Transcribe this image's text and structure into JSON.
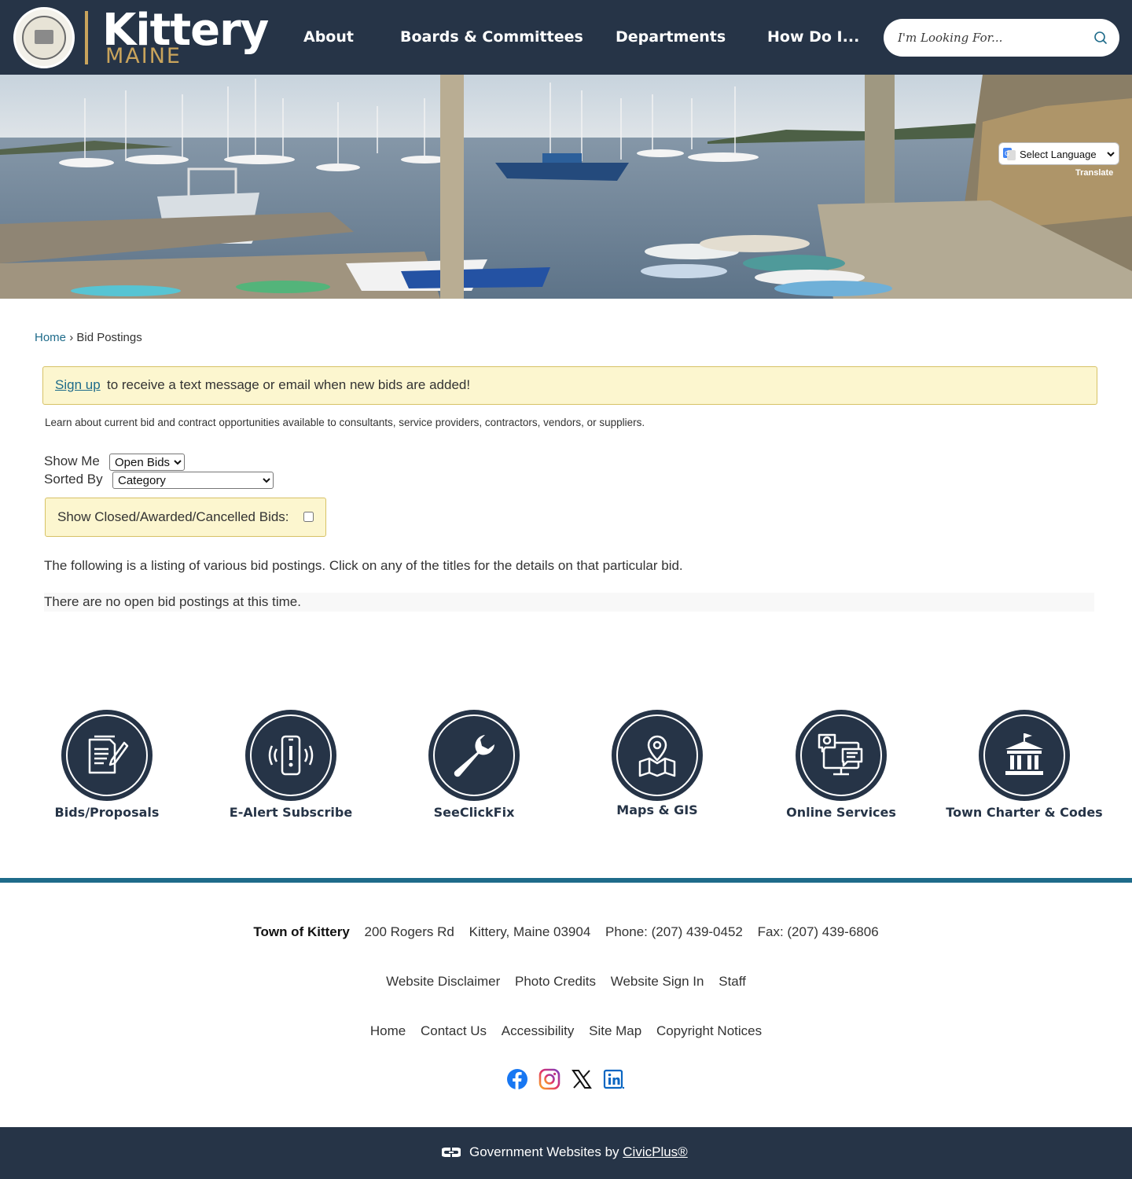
{
  "header": {
    "logo_name": "Kittery",
    "logo_state": "MAINE",
    "nav": [
      {
        "label": "About"
      },
      {
        "label": "Boards & Committees"
      },
      {
        "label": "Departments"
      },
      {
        "label": "How Do I..."
      }
    ],
    "search": {
      "placeholder": "I'm Looking For...",
      "icon": "search-icon"
    }
  },
  "translate": {
    "select_label": "Select Language",
    "credit": "Translate"
  },
  "breadcrumb": {
    "home": "Home",
    "separator": "›",
    "current": "Bid Postings"
  },
  "alert": {
    "link": "Sign up",
    "text": "to receive a text message or email when new bids are added!"
  },
  "intro": "Learn about current bid and contract opportunities available to consultants, service providers, contractors, vendors, or suppliers.",
  "filters": {
    "show_me_label": "Show Me",
    "show_me_value": "Open Bids",
    "sorted_by_label": "Sorted By",
    "sorted_by_value": "Category",
    "closed_label": "Show Closed/Awarded/Cancelled Bids:",
    "closed_checked": false
  },
  "listing_text": "The following is a listing of various bid postings. Click on any of the titles for the details on that particular bid.",
  "no_bids_text": "There are no open bid postings at this time.",
  "quick_links": [
    {
      "label": "Bids/Proposals",
      "icon": "document-pen-icon"
    },
    {
      "label": "E-Alert Subscribe",
      "icon": "phone-alert-icon"
    },
    {
      "label": "SeeClickFix",
      "icon": "wrench-icon"
    },
    {
      "label": "Maps & GIS",
      "icon": "map-pin-icon"
    },
    {
      "label": "Online Services",
      "icon": "computer-chat-icon"
    },
    {
      "label": "Town Charter & Codes",
      "icon": "town-hall-icon"
    }
  ],
  "footer": {
    "org": "Town of Kittery",
    "address": "200 Rogers Rd",
    "city": "Kittery, Maine 03904",
    "phone": "Phone: (207) 439-0452",
    "fax": "Fax: (207) 439-6806",
    "links_row1": [
      "Website Disclaimer",
      "Photo Credits",
      "Website Sign In",
      "Staff"
    ],
    "links_row2": [
      "Home",
      "Contact Us",
      "Accessibility",
      "Site Map",
      "Copyright Notices"
    ],
    "social": [
      "facebook-icon",
      "instagram-icon",
      "x-icon",
      "linkedin-icon"
    ]
  },
  "bottom": {
    "text": "Government Websites by",
    "link": "CivicPlus®"
  },
  "colors": {
    "navy": "#263447",
    "gold": "#c9a45c",
    "teal": "#1e6b8a",
    "alert_bg": "#fcf6cf"
  }
}
